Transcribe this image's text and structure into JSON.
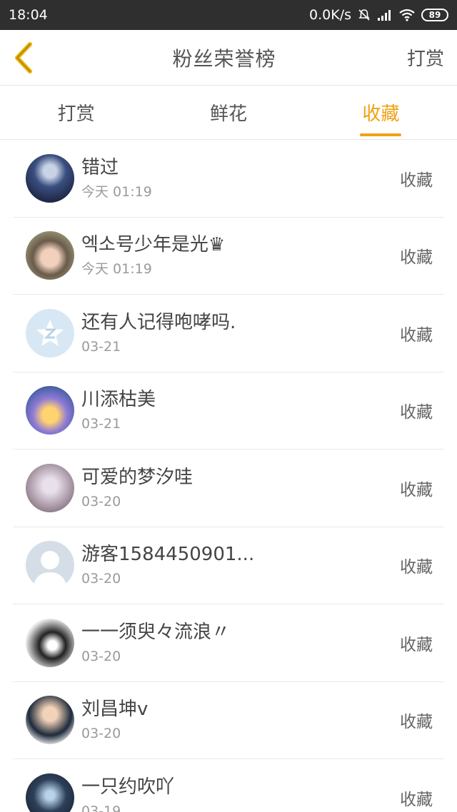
{
  "status_bar": {
    "time": "18:04",
    "network_speed": "0.0K/s",
    "battery": "89",
    "icons": [
      "mute-bell-icon",
      "signal-icon",
      "wifi-icon",
      "battery-icon"
    ]
  },
  "nav": {
    "back_icon": "chevron-left-icon",
    "title": "粉丝荣誉榜",
    "action": "打赏"
  },
  "tabs": [
    {
      "label": "打赏",
      "active": false
    },
    {
      "label": "鲜花",
      "active": false
    },
    {
      "label": "收藏",
      "active": true
    }
  ],
  "colors": {
    "accent": "#f0a112",
    "status_bar_bg": "#2f2f2f",
    "text_primary": "#444444",
    "text_secondary": "#9a9a9a"
  },
  "fans": [
    {
      "name": "错过",
      "time": "今天 01:19",
      "action": "收藏"
    },
    {
      "name": "엑소号少年是光♛",
      "time": "今天 01:19",
      "action": "收藏"
    },
    {
      "name": "还有人记得咆哮吗.",
      "time": "03-21",
      "action": "收藏"
    },
    {
      "name": "川添枯美",
      "time": "03-21",
      "action": "收藏"
    },
    {
      "name": "可爱的梦汐哇",
      "time": "03-20",
      "action": "收藏"
    },
    {
      "name": "游客1584450901...",
      "time": "03-20",
      "action": "收藏"
    },
    {
      "name": "一一须臾々流浪〃",
      "time": "03-20",
      "action": "收藏"
    },
    {
      "name": "刘昌坤v",
      "time": "03-20",
      "action": "收藏"
    },
    {
      "name": "一只约吹吖",
      "time": "03-19",
      "action": "收藏"
    }
  ]
}
